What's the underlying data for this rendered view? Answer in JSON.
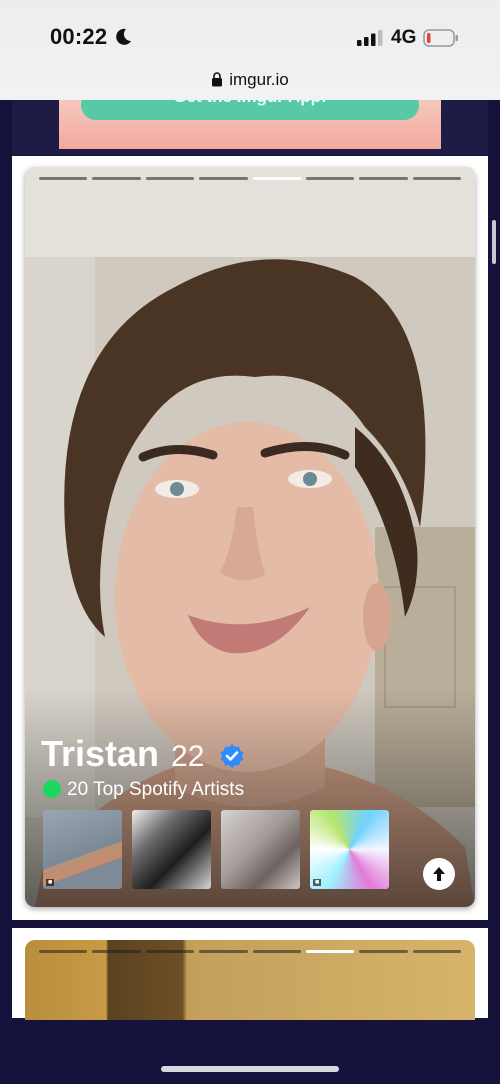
{
  "status_bar": {
    "time": "00:22",
    "network": "4G",
    "focus_icon": "moon-icon"
  },
  "browser": {
    "url": "imgur.io",
    "lock_icon": "lock-icon"
  },
  "banner": {
    "button_label": "Get the Imgur App!",
    "button_color": "#58c9a6"
  },
  "profile_card": {
    "name": "Tristan",
    "age": "22",
    "verified_icon": "verified-badge-icon",
    "spotify_text": "20 Top Spotify Artists",
    "photo_count": 8,
    "active_photo_index": 4,
    "albums": [
      {
        "name": "album-cover-1"
      },
      {
        "name": "album-cover-2"
      },
      {
        "name": "album-cover-3"
      },
      {
        "name": "album-cover-4"
      }
    ],
    "expand_icon": "arrow-up-icon"
  },
  "next_card": {
    "photo_count": 8,
    "active_photo_index": 5
  },
  "colors": {
    "background": "#15133b",
    "spotify_green": "#1ed760",
    "verified_blue": "#2a8cff"
  }
}
